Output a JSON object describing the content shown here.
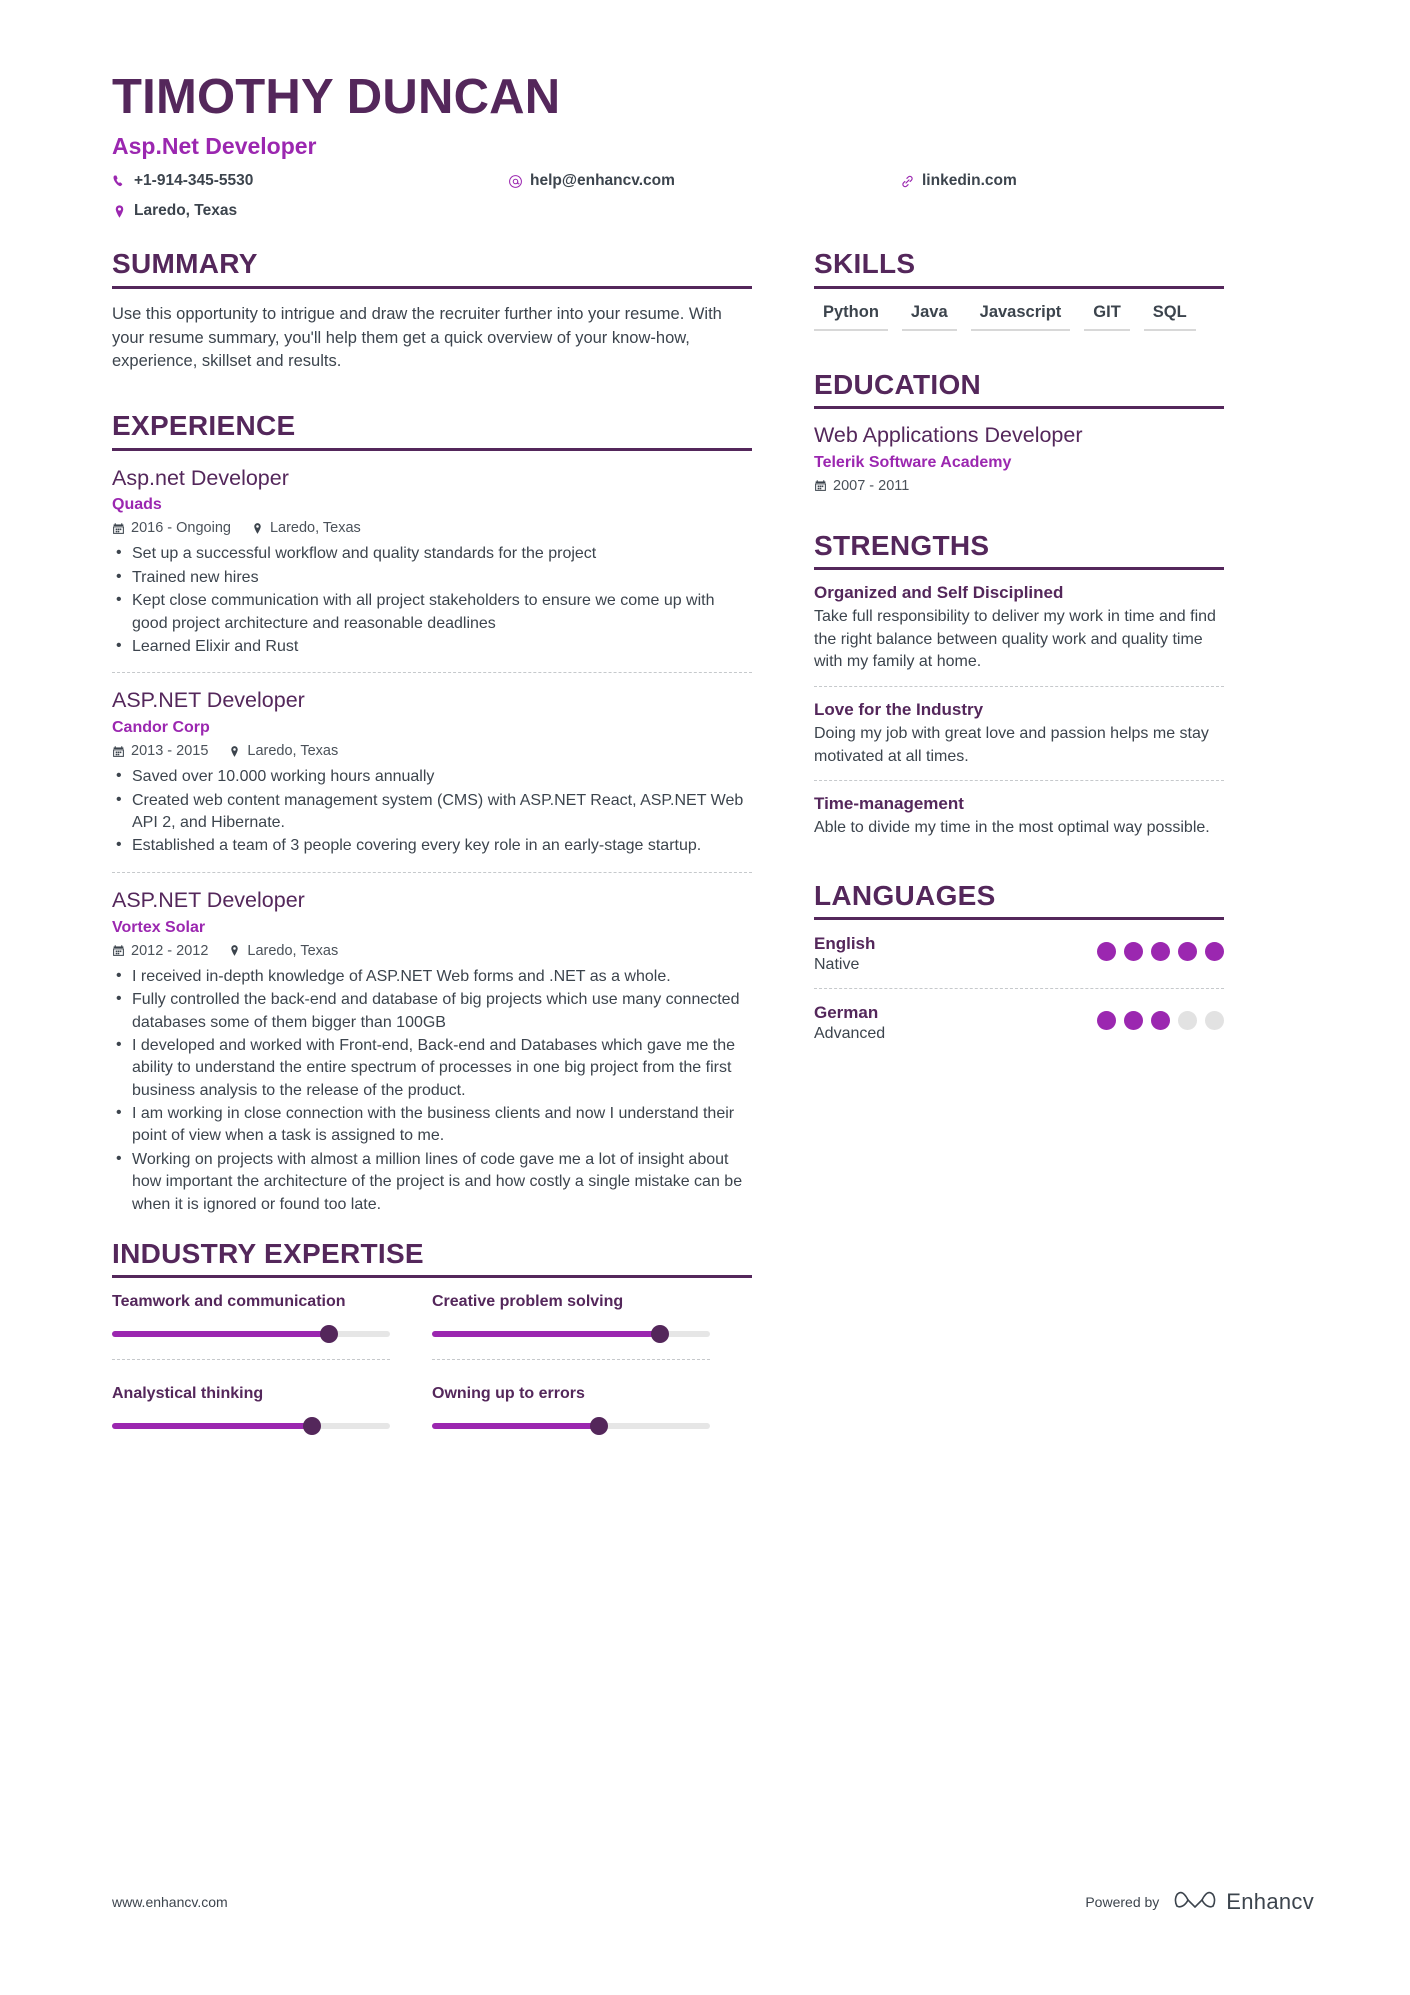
{
  "header": {
    "name": "TIMOTHY DUNCAN",
    "job_title": "Asp.Net Developer",
    "contacts": {
      "phone": "+1-914-345-5530",
      "email": "help@enhancv.com",
      "linkedin": "linkedin.com",
      "location": "Laredo, Texas"
    }
  },
  "summary": {
    "heading": "SUMMARY",
    "text": "Use this opportunity to intrigue and draw the recruiter further into your resume. With your resume summary, you'll help them get a quick overview of your know-how, experience, skillset and results."
  },
  "experience": {
    "heading": "EXPERIENCE",
    "jobs": [
      {
        "role": "Asp.net Developer",
        "company": "Quads",
        "dates": "2016 - Ongoing",
        "location": "Laredo, Texas",
        "bullets": [
          "Set up a successful workflow and quality standards for the project",
          "Trained new hires",
          "Kept close communication with all project stakeholders to ensure we come up with good project architecture and reasonable deadlines",
          "Learned Elixir and Rust"
        ]
      },
      {
        "role": "ASP.NET Developer",
        "company": "Candor Corp",
        "dates": "2013 - 2015",
        "location": "Laredo, Texas",
        "bullets": [
          "Saved over 10.000 working hours annually",
          "Created web content management system (CMS) with ASP.NET React, ASP.NET Web API 2, and Hibernate.",
          "Established a team of 3 people covering every key role in an early-stage startup."
        ]
      },
      {
        "role": "ASP.NET Developer",
        "company": "Vortex Solar",
        "dates": "2012 - 2012",
        "location": "Laredo, Texas",
        "bullets": [
          "I received in-depth knowledge of ASP.NET Web forms and .NET as a whole.",
          "Fully controlled the back-end and database of big projects which use many connected databases some of them bigger than 100GB",
          "I developed and worked with Front-end, Back-end and Databases which gave me the ability to understand the entire spectrum of processes in one big project from the first business analysis to the release of the product.",
          "I am working in close connection with the business clients and now I understand their point of view when a task is assigned to me.",
          "Working on projects with almost a million lines of code gave me a lot of insight about how important the architecture of the project is and how costly a single mistake can be when it is ignored or found too late."
        ]
      }
    ]
  },
  "industry_expertise": {
    "heading": "INDUSTRY EXPERTISE",
    "items": [
      {
        "label": "Teamwork and communication",
        "level": 78
      },
      {
        "label": "Creative problem solving",
        "level": 82
      },
      {
        "label": "Analystical thinking",
        "level": 72
      },
      {
        "label": "Owning up to errors",
        "level": 60
      }
    ]
  },
  "skills": {
    "heading": "SKILLS",
    "items": [
      "Python",
      "Java",
      "Javascript",
      "GIT",
      "SQL"
    ]
  },
  "education": {
    "heading": "EDUCATION",
    "entries": [
      {
        "degree": "Web Applications Developer",
        "school": "Telerik Software Academy",
        "dates": "2007 - 2011"
      }
    ]
  },
  "strengths": {
    "heading": "STRENGTHS",
    "items": [
      {
        "title": "Organized and Self Disciplined",
        "description": "Take full responsibility to deliver my work in time and find the right balance between quality work and quality time with my family at home."
      },
      {
        "title": "Love for the Industry",
        "description": "Doing my job with great love and passion helps me stay motivated at all times."
      },
      {
        "title": "Time-management",
        "description": "Able to divide my time in the most optimal way possible."
      }
    ]
  },
  "languages": {
    "heading": "LANGUAGES",
    "items": [
      {
        "name": "English",
        "level": "Native",
        "filled": 5,
        "total": 5
      },
      {
        "name": "German",
        "level": "Advanced",
        "filled": 3,
        "total": 5
      }
    ]
  },
  "footer": {
    "url": "www.enhancv.com",
    "powered_by": "Powered by",
    "brand": "Enhancv"
  },
  "colors": {
    "primary": "#54275b",
    "accent": "#9b27b0",
    "text": "#3c444d",
    "muted": "#e2e2e2"
  }
}
